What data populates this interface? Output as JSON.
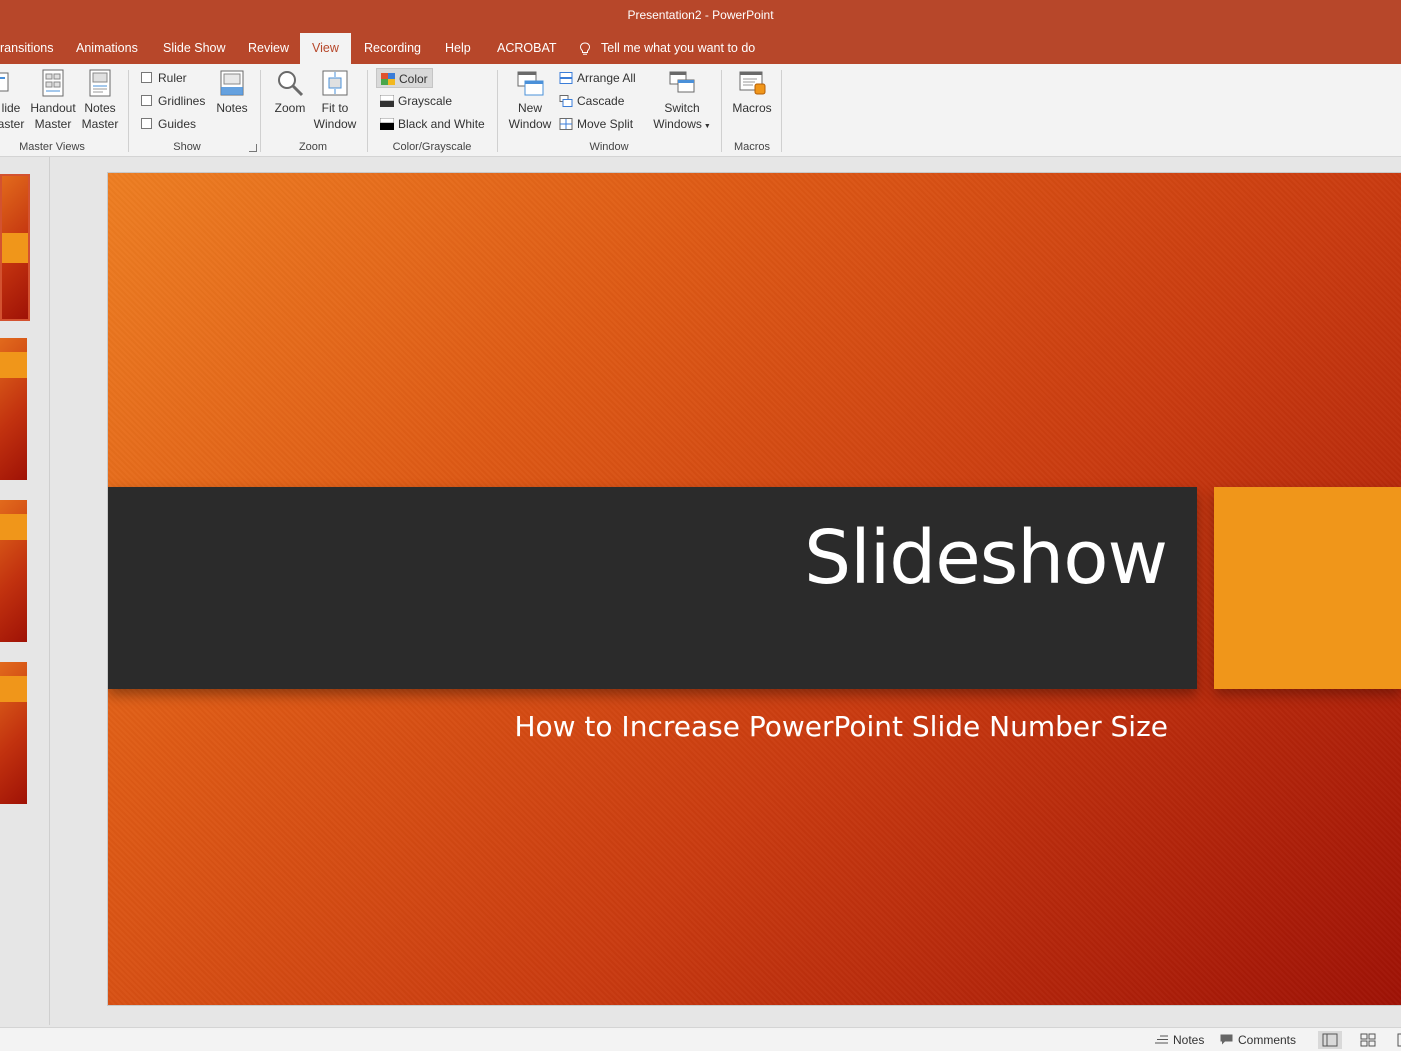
{
  "window": {
    "title": "Presentation2  -  PowerPoint"
  },
  "tabs": [
    {
      "label": "ransitions"
    },
    {
      "label": "Animations"
    },
    {
      "label": "Slide Show"
    },
    {
      "label": "Review"
    },
    {
      "label": "View",
      "active": true
    },
    {
      "label": "Recording"
    },
    {
      "label": "Help"
    },
    {
      "label": "ACROBAT"
    }
  ],
  "tell_me": "Tell me what you want to do",
  "ribbon": {
    "master_views": {
      "label": "Master Views",
      "slide_master": {
        "line1": "lide",
        "line2": "aster"
      },
      "handout_master": {
        "line1": "Handout",
        "line2": "Master"
      },
      "notes_master": {
        "line1": "Notes",
        "line2": "Master"
      }
    },
    "show": {
      "label": "Show",
      "ruler": "Ruler",
      "gridlines": "Gridlines",
      "guides": "Guides",
      "notes": "Notes"
    },
    "zoom": {
      "label": "Zoom",
      "zoom": "Zoom",
      "fit_line1": "Fit to",
      "fit_line2": "Window"
    },
    "color_grayscale": {
      "label": "Color/Grayscale",
      "color": "Color",
      "grayscale": "Grayscale",
      "black_white": "Black and White"
    },
    "window": {
      "label": "Window",
      "new_line1": "New",
      "new_line2": "Window",
      "arrange_all": "Arrange All",
      "cascade": "Cascade",
      "move_split": "Move Split",
      "switch_line1": "Switch",
      "switch_line2": "Windows"
    },
    "macros": {
      "label": "Macros",
      "macros": "Macros"
    }
  },
  "slide": {
    "title": "Slideshow",
    "subtitle": "How to Increase PowerPoint Slide Number Size"
  },
  "statusbar": {
    "notes": "Notes",
    "comments": "Comments"
  },
  "colors": {
    "accent": "#b7472a",
    "slide_band": "#2b2b2b",
    "slide_accent": "#f0961a"
  }
}
